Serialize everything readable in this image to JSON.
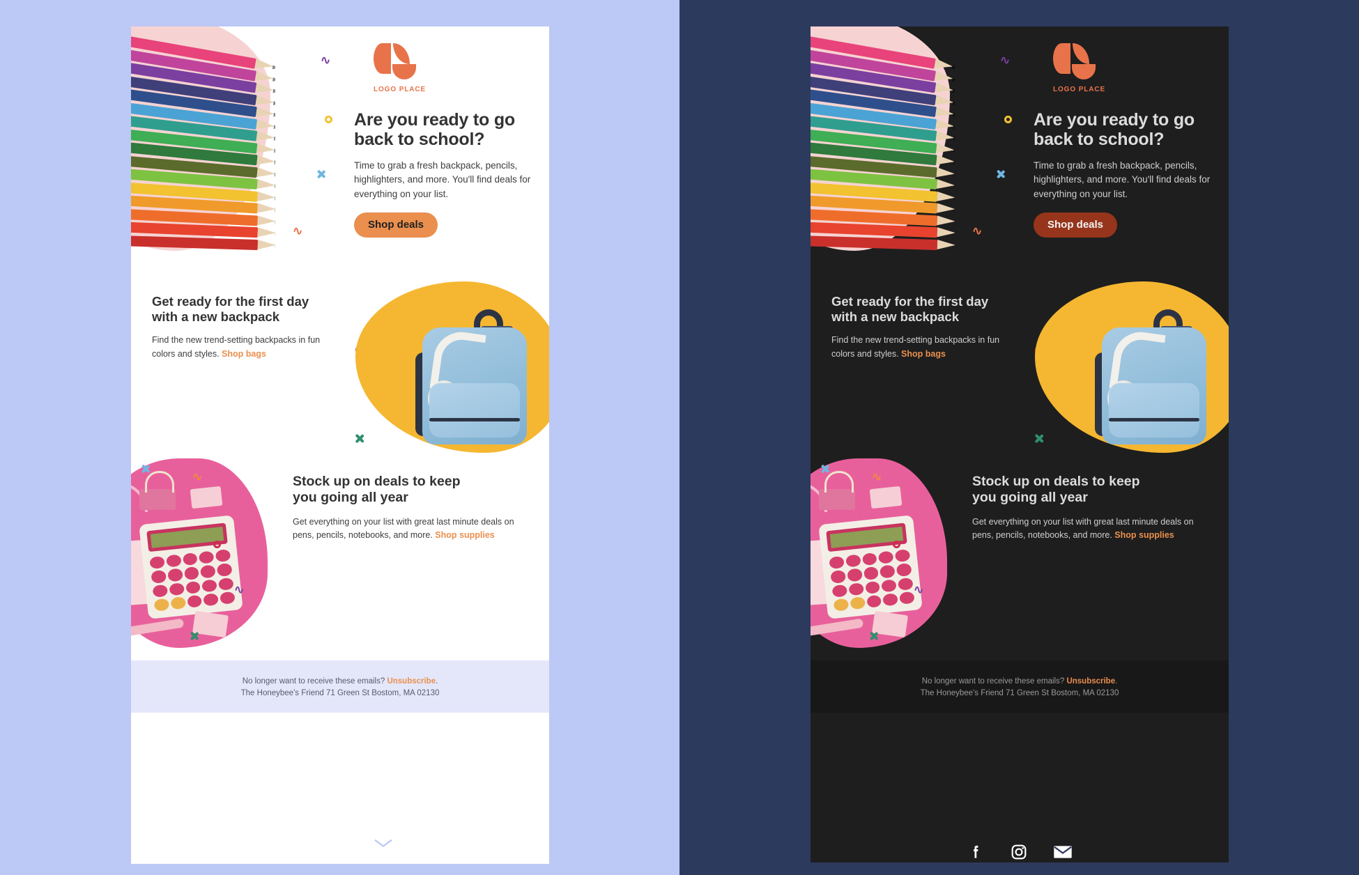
{
  "page": {
    "background_left": "#bcc8f5",
    "background_right": "#2c3a5e",
    "accent_orange": "#ea8f4e",
    "logo_orange": "#e8734a",
    "dark_surface": "#1e1e1e",
    "dark_button": "#96351b"
  },
  "email": {
    "logo": {
      "name": "LOGO PLACE",
      "icon": "leaf-petals-logo"
    },
    "hero": {
      "heading": "Are you ready to go\nback to school?",
      "body": "Time to grab a fresh backpack, pencils,\nhighlighters, and more. You'll find deals for\neverything on your list.",
      "cta": "Shop deals"
    },
    "section2": {
      "heading": "Get ready for the first day\nwith a new backpack",
      "body": "Find the new trend-setting backpacks in fun colors and styles. ",
      "link": "Shop bags"
    },
    "section3": {
      "heading": "Stock up on deals to keep\nyou going all year",
      "body": "Get everything on your list with great last minute deals on pens, pencils, notebooks, and more. ",
      "link": "Shop supplies"
    },
    "footer": {
      "line1_prefix": "No longer want to receive these emails? ",
      "unsubscribe": "Unsubscribe",
      "line1_suffix": ".",
      "line2": "The Honeybee's Friend 71 Green St Bostom, MA 02130"
    },
    "socials": [
      {
        "name": "facebook-icon",
        "label": "Facebook"
      },
      {
        "name": "instagram-icon",
        "label": "Instagram"
      },
      {
        "name": "email-icon",
        "label": "Email"
      }
    ]
  },
  "pencil_colors": [
    "#e8437a",
    "#c0449b",
    "#7b3fa0",
    "#3f3f7a",
    "#2e4f8c",
    "#4aa3d4",
    "#2f9e8f",
    "#3fae54",
    "#2f7a3c",
    "#5b6b2c",
    "#7ec242",
    "#f2c230",
    "#f09a2b",
    "#ef6d2b",
    "#e8432e",
    "#c9302c"
  ],
  "backpack_pencils": [
    "#4caf50",
    "#2196f3",
    "#e91e63",
    "#f44336",
    "#ffc107",
    "#8bc34a"
  ]
}
